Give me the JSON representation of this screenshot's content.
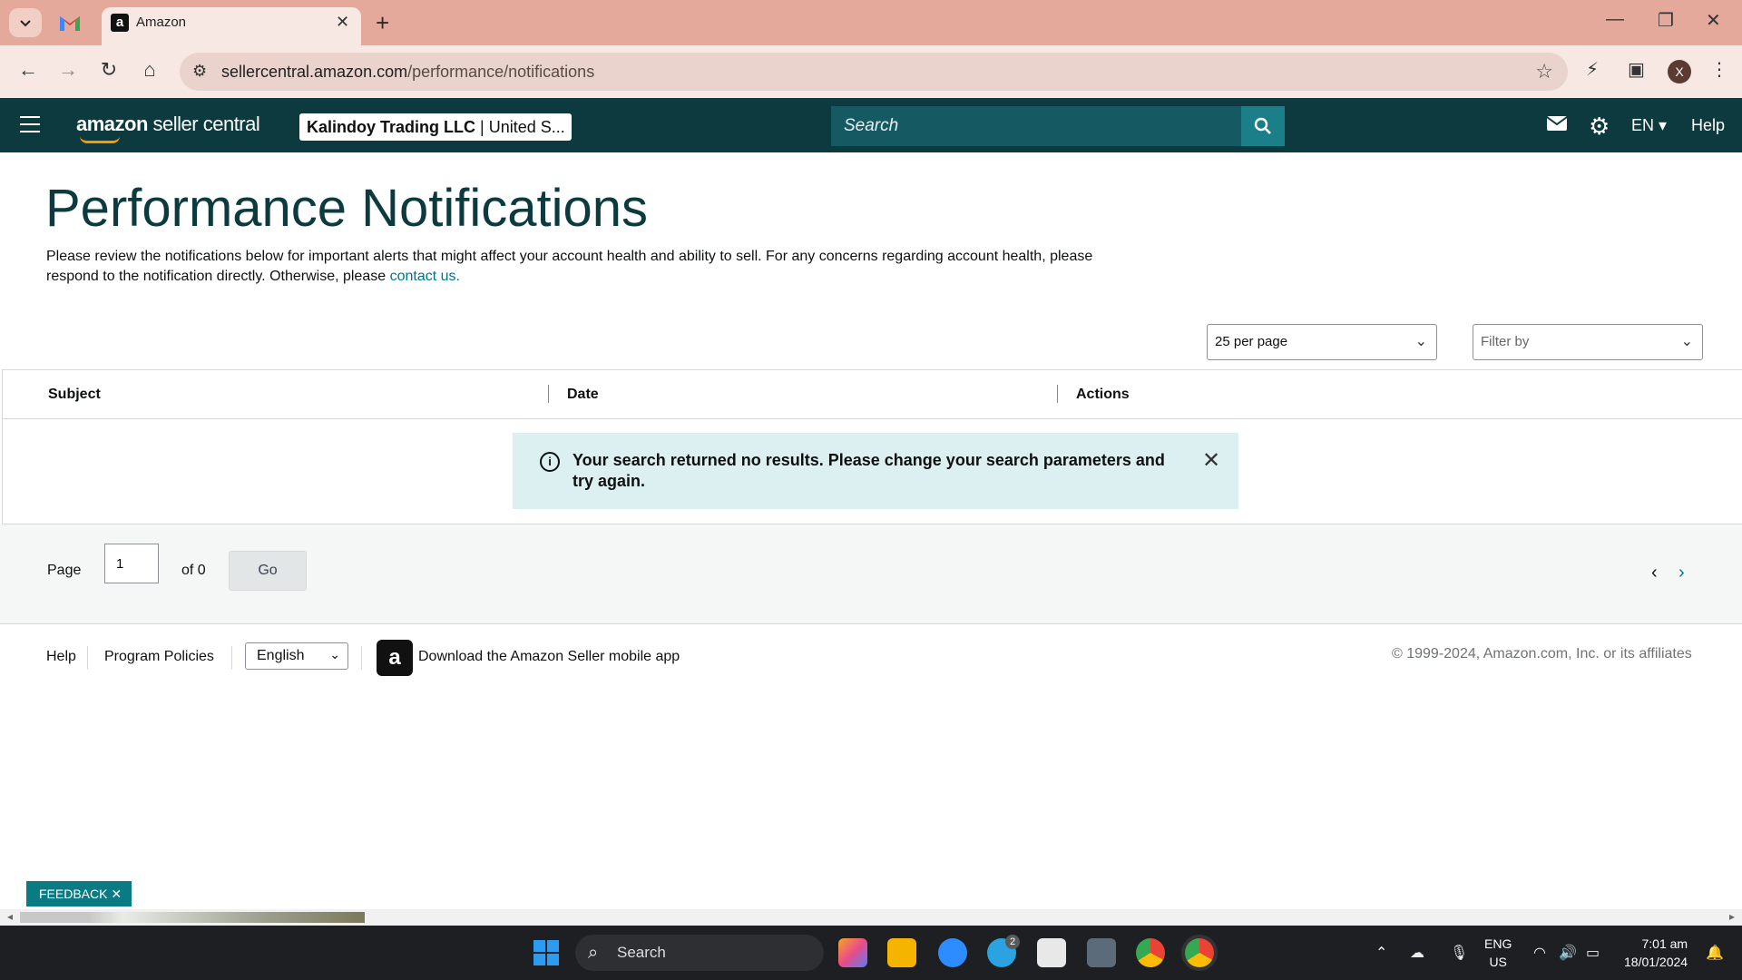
{
  "browser": {
    "tab_title": "Amazon",
    "tab_favicon": "a",
    "url_host": "sellercentral.amazon.com",
    "url_path": "/performance/notifications",
    "profile_initial": "X"
  },
  "header": {
    "logo_amazon": "amazon",
    "logo_product": " seller central",
    "account_name": "Kalindoy Trading LLC",
    "account_region": " | United S...",
    "search_placeholder": "Search",
    "language": "EN",
    "help": "Help"
  },
  "page": {
    "title": "Performance Notifications",
    "description": "Please review the notifications below for important alerts that might affect your account health and ability to sell. For any concerns regarding account health, please respond to the notification directly. Otherwise, please ",
    "contact_link": "contact us."
  },
  "controls": {
    "per_page": "25 per page",
    "filter_placeholder": "Filter by"
  },
  "table": {
    "columns": [
      "Subject",
      "Date",
      "Actions"
    ],
    "alert_message": "Your search returned no results. Please change your search parameters and try again."
  },
  "pagination": {
    "page_label": "Page",
    "current_page": "1",
    "of_label": "of 0",
    "go_label": "Go"
  },
  "footer": {
    "help": "Help",
    "program_policies": "Program Policies",
    "language": "English",
    "app_promo": "Download the Amazon Seller mobile app",
    "copyright": "© 1999-2024, Amazon.com, Inc. or its affiliates"
  },
  "feedback": {
    "label": "FEEDBACK"
  },
  "taskbar": {
    "search": "Search",
    "telegram_badge": "2",
    "lang_line1": "ENG",
    "lang_line2": "US",
    "time": "7:01 am",
    "date": "18/01/2024"
  },
  "colors": {
    "header_bg": "#0c3a3f",
    "search_bg": "#155a63",
    "search_button": "#1b7f8a",
    "alert_bg": "#dceff1",
    "link": "#00768a",
    "feedback_bg": "#0a7b83",
    "tabstrip": "#e4a99a"
  }
}
